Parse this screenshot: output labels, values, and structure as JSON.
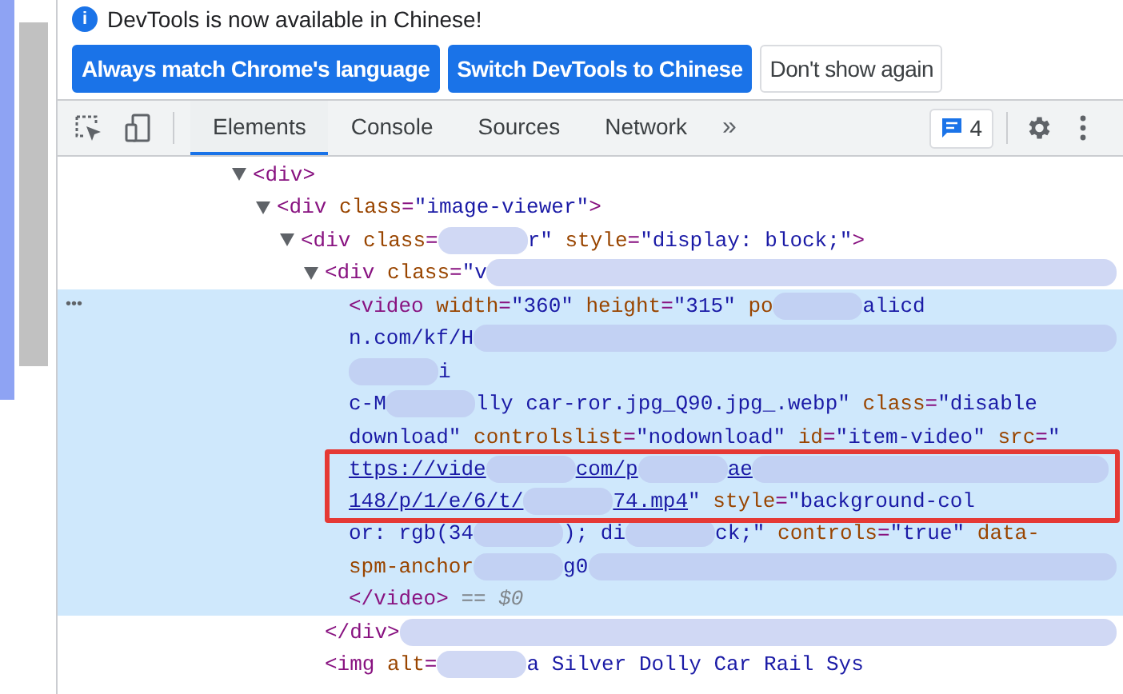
{
  "infobar": {
    "icon": "i",
    "message": "DevTools is now available in Chinese!",
    "buttons": [
      {
        "label": "Always match Chrome's language",
        "kind": "primary"
      },
      {
        "label": "Switch DevTools to Chinese",
        "kind": "primary"
      },
      {
        "label": "Don't show again",
        "kind": "secondary"
      }
    ]
  },
  "toolbar": {
    "tabs": [
      {
        "label": "Elements",
        "selected": true
      },
      {
        "label": "Console",
        "selected": false
      },
      {
        "label": "Sources",
        "selected": false
      },
      {
        "label": "Network",
        "selected": false
      }
    ],
    "more": "»",
    "issues_count": "4"
  },
  "tree": {
    "gutter": "•••",
    "nodes": [
      {
        "expander": true,
        "selected": false,
        "lines": [
          {
            "segments": [
              {
                "kind": "tag",
                "text": "<div>"
              }
            ]
          }
        ],
        "children": [
          {
            "expander": true,
            "selected": false,
            "lines": [
              {
                "segments": [
                  {
                    "kind": "tag",
                    "text": "<div "
                  },
                  {
                    "kind": "attr",
                    "text": "class"
                  },
                  {
                    "kind": "tag",
                    "text": "="
                  },
                  {
                    "kind": "value",
                    "text": "\"image-viewer\""
                  },
                  {
                    "kind": "tag",
                    "text": ">"
                  }
                ]
              }
            ],
            "children": [
              {
                "expander": true,
                "selected": false,
                "lines": [
                  {
                    "segments": [
                      {
                        "kind": "tag",
                        "text": "<div "
                      },
                      {
                        "kind": "attr",
                        "text": "class"
                      },
                      {
                        "kind": "tag",
                        "text": "="
                      },
                      {
                        "kind": "value",
                        "text": "r\"",
                        "blur_before": true
                      },
                      {
                        "kind": "attr",
                        "text": " style"
                      },
                      {
                        "kind": "tag",
                        "text": "="
                      },
                      {
                        "kind": "value",
                        "text": "\"display: block;\""
                      },
                      {
                        "kind": "tag",
                        "text": ">"
                      }
                    ]
                  }
                ],
                "children": [
                  {
                    "expander": true,
                    "selected": false,
                    "lines": [
                      {
                        "segments": [
                          {
                            "kind": "tag",
                            "text": "<div "
                          },
                          {
                            "kind": "attr",
                            "text": "class"
                          },
                          {
                            "kind": "tag",
                            "text": "="
                          },
                          {
                            "kind": "value",
                            "text": "\"v",
                            "blur_after": true
                          }
                        ]
                      }
                    ],
                    "children": [
                      {
                        "expander": false,
                        "selected": true,
                        "lines": [
                          {
                            "highlighted": false,
                            "segments": [
                              {
                                "kind": "tag",
                                "text": "<video "
                              },
                              {
                                "kind": "attr",
                                "text": "width"
                              },
                              {
                                "kind": "tag",
                                "text": "="
                              },
                              {
                                "kind": "value",
                                "text": "\"360\""
                              },
                              {
                                "kind": "attr",
                                "text": " height"
                              },
                              {
                                "kind": "tag",
                                "text": "="
                              },
                              {
                                "kind": "value",
                                "text": "\"315\""
                              },
                              {
                                "kind": "attr",
                                "text": " po"
                              },
                              {
                                "kind": "value",
                                "text": "alicd",
                                "blur_before": true
                              }
                            ]
                          },
                          {
                            "highlighted": false,
                            "segments": [
                              {
                                "kind": "value",
                                "text": "n.com/kf/H",
                                "blur_after": true
                              }
                            ]
                          },
                          {
                            "highlighted": false,
                            "segments": [
                              {
                                "kind": "value",
                                "text": "i",
                                "blur_before": true
                              }
                            ]
                          },
                          {
                            "highlighted": false,
                            "segments": [
                              {
                                "kind": "value",
                                "text": "c-M"
                              },
                              {
                                "kind": "value",
                                "text": "lly car-ror.jpg_Q90.jpg_.webp\"",
                                "blur_before": true
                              },
                              {
                                "kind": "attr",
                                "text": " class"
                              },
                              {
                                "kind": "tag",
                                "text": "="
                              },
                              {
                                "kind": "value",
                                "text": "\"disable"
                              }
                            ]
                          },
                          {
                            "highlighted": false,
                            "segments": [
                              {
                                "kind": "value",
                                "text": "download\""
                              },
                              {
                                "kind": "attr",
                                "text": " controlslist"
                              },
                              {
                                "kind": "tag",
                                "text": "="
                              },
                              {
                                "kind": "value",
                                "text": "\"nodownload\""
                              },
                              {
                                "kind": "attr",
                                "text": " id"
                              },
                              {
                                "kind": "tag",
                                "text": "="
                              },
                              {
                                "kind": "value",
                                "text": "\"item-video\""
                              },
                              {
                                "kind": "attr",
                                "text": " src"
                              },
                              {
                                "kind": "tag",
                                "text": "="
                              },
                              {
                                "kind": "value",
                                "text": "\""
                              }
                            ]
                          },
                          {
                            "highlighted": true,
                            "segments": [
                              {
                                "kind": "link",
                                "text": "ttps://vide"
                              },
                              {
                                "kind": "link",
                                "text": "com/p",
                                "blur_before": true
                              },
                              {
                                "kind": "link",
                                "text": "ae",
                                "blur_before": true,
                                "blur_after": true
                              }
                            ]
                          },
                          {
                            "highlighted": true,
                            "segments": [
                              {
                                "kind": "link",
                                "text": "148/p/1/e/6/t/"
                              },
                              {
                                "kind": "link",
                                "text": "74.mp4",
                                "blur_before": true
                              },
                              {
                                "kind": "value",
                                "text": "\""
                              },
                              {
                                "kind": "attr",
                                "text": " style"
                              },
                              {
                                "kind": "tag",
                                "text": "="
                              },
                              {
                                "kind": "value",
                                "text": "\"background-col"
                              }
                            ]
                          },
                          {
                            "highlighted": false,
                            "segments": [
                              {
                                "kind": "value",
                                "text": "or: rgb(34"
                              },
                              {
                                "kind": "value",
                                "text": "); di",
                                "blur_before": true
                              },
                              {
                                "kind": "value",
                                "text": "ck;\"",
                                "blur_before": true
                              },
                              {
                                "kind": "attr",
                                "text": " controls"
                              },
                              {
                                "kind": "tag",
                                "text": "="
                              },
                              {
                                "kind": "value",
                                "text": "\"true\""
                              },
                              {
                                "kind": "attr",
                                "text": " data-"
                              }
                            ]
                          },
                          {
                            "highlighted": false,
                            "segments": [
                              {
                                "kind": "attr",
                                "text": "spm-anchor"
                              },
                              {
                                "kind": "value",
                                "text": "g0",
                                "blur_before": true,
                                "blur_after": true
                              }
                            ]
                          },
                          {
                            "highlighted": false,
                            "segments": [
                              {
                                "kind": "tag",
                                "text": "</video>"
                              },
                              {
                                "kind": "plain",
                                "text": " == $0"
                              }
                            ]
                          }
                        ]
                      }
                    ],
                    "closing": [
                      {
                        "kind": "tag",
                        "text": "</div>",
                        "blur_after": true
                      }
                    ]
                  },
                  {
                    "expander": false,
                    "selected": false,
                    "lines": [
                      {
                        "segments": [
                          {
                            "kind": "tag",
                            "text": "<img "
                          },
                          {
                            "kind": "attr",
                            "text": "alt"
                          },
                          {
                            "kind": "tag",
                            "text": "="
                          },
                          {
                            "kind": "value",
                            "text": "a Silver Dolly Car Rail Sys",
                            "blur_before": true
                          }
                        ]
                      }
                    ]
                  }
                ]
              }
            ]
          }
        ]
      }
    ]
  }
}
